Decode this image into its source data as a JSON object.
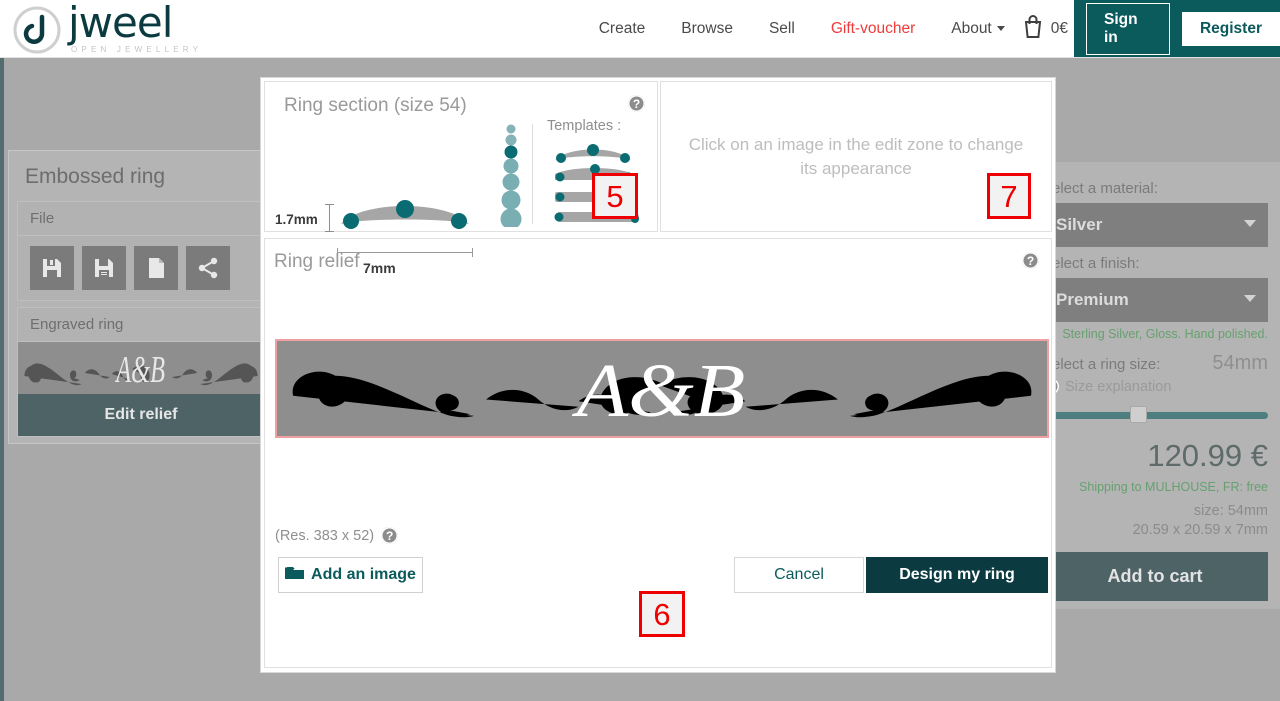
{
  "header": {
    "logo_word": "jweel",
    "logo_tagline": "OPEN JEWELLERY",
    "nav": [
      {
        "label": "Create",
        "accent": false
      },
      {
        "label": "Browse",
        "accent": false
      },
      {
        "label": "Sell",
        "accent": false
      },
      {
        "label": "Gift-voucher",
        "accent": true
      }
    ],
    "about_label": "About",
    "cart_amount": "0€",
    "sign_in": "Sign in",
    "register": "Register",
    "accent_color": "#ef3b3b",
    "brand_color": "#0b5a5c"
  },
  "left_panel": {
    "title": "Embossed ring",
    "file_group_label": "File",
    "file_icons": [
      "save-icon",
      "save-as-icon",
      "new-file-icon",
      "share-icon"
    ],
    "relief_group_label": "Engraved ring",
    "edit_relief_label": "Edit relief"
  },
  "right_panel": {
    "material_label": "Select a material:",
    "material_value": "Silver",
    "finish_label": "Select a finish:",
    "finish_value": "Premium",
    "finish_note": "Sterling Silver, Gloss. Hand polished.",
    "size_label": "Select a ring size:",
    "size_value": "54mm",
    "size_explanation": "Size explanation",
    "price": "120.99 €",
    "shipping": "Shipping to MULHOUSE, FR: free",
    "dims_size": "size: 54mm",
    "dims_box": "20.59 x 20.59 x 7mm",
    "add_to_cart": "Add to cart",
    "note_color": "#67a070"
  },
  "modal": {
    "section_title": "Ring section (size 54)",
    "dim_height": "1.7mm",
    "dim_width": "7mm",
    "templates_label": "Templates :",
    "preview_message": "Click on an image in the edit zone to change its appearance",
    "relief_title": "Ring relief",
    "relief_text": "A&B",
    "resolution": "(Res.  383 x 52)",
    "add_image_label": "Add an image",
    "cancel_label": "Cancel",
    "design_label": "Design my ring",
    "highlight_color": "#f0a0a0"
  },
  "annotations": [
    {
      "id": "badge5",
      "number": "5"
    },
    {
      "id": "badge6",
      "number": "6"
    },
    {
      "id": "badge7",
      "number": "7"
    }
  ]
}
